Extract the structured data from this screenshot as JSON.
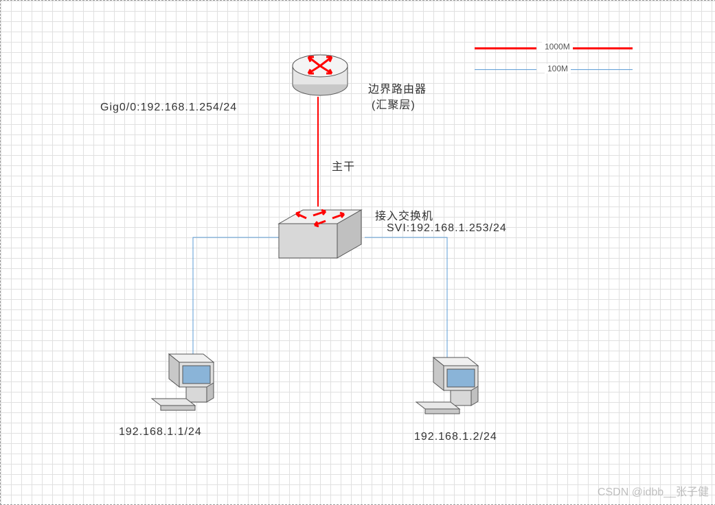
{
  "legend": {
    "line1000": "1000M",
    "line100": "100M"
  },
  "router": {
    "label1": "边界路由器",
    "label2": "(汇聚层)",
    "interface": "Gig0/0:192.168.1.254/24"
  },
  "trunk": {
    "label": "主干"
  },
  "switch": {
    "label1": "接入交换机",
    "label2": "SVI:192.168.1.253/24"
  },
  "host1": {
    "ip": "192.168.1.1/24"
  },
  "host2": {
    "ip": "192.168.1.2/24"
  },
  "watermark": "CSDN @idbb__张子健"
}
